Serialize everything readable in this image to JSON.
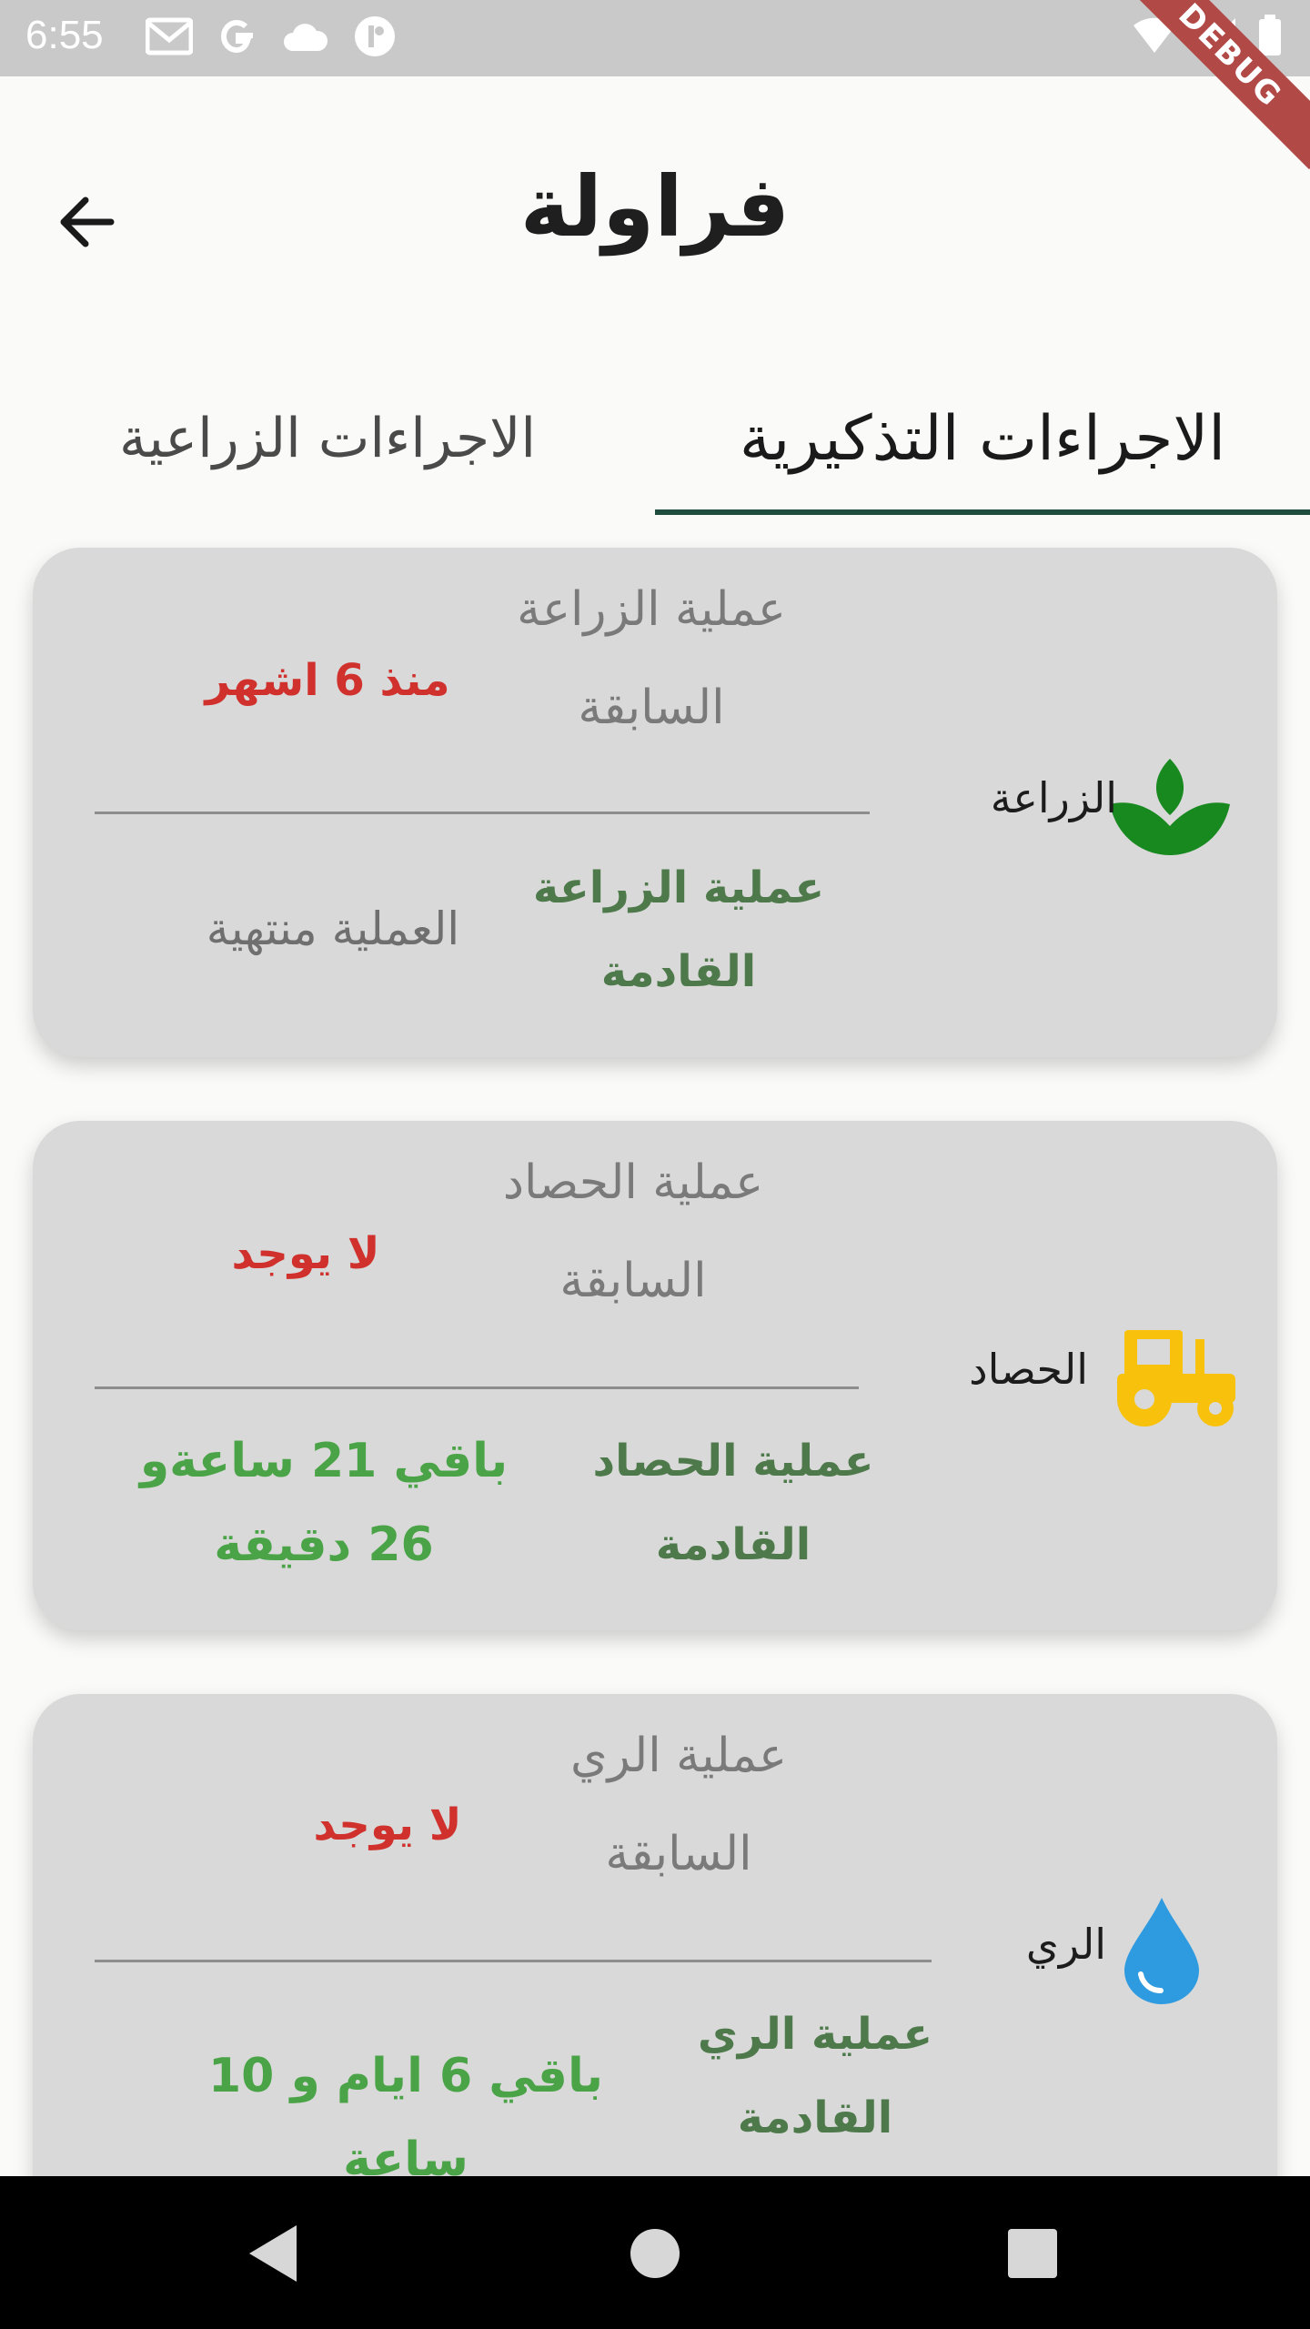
{
  "status_bar": {
    "time": "6:55",
    "debug": "DEBUG"
  },
  "header": {
    "title": "فراولة"
  },
  "tabs": {
    "reminder": "الاجراءات التذكيرية",
    "agricultural": "الاجراءات الزراعية"
  },
  "cards": [
    {
      "name": "الزراعة",
      "icon": "plant-icon",
      "prev_label": "عملية الزراعة السابقة",
      "prev_value": "منذ 6 اشهر",
      "next_label": "عملية الزراعة القادمة",
      "next_value": "العملية منتهية"
    },
    {
      "name": "الحصاد",
      "icon": "tractor-icon",
      "prev_label": "عملية الحصاد السابقة",
      "prev_value": "لا يوجد",
      "next_label": "عملية الحصاد القادمة",
      "next_value": "باقي 21 ساعةو 26 دقيقة"
    },
    {
      "name": "الري",
      "icon": "water-drop-icon",
      "prev_label": "عملية الري السابقة",
      "prev_value": "لا يوجد",
      "next_label": "عملية الري القادمة",
      "next_value": "باقي 6 ايام و 10 ساعة"
    }
  ],
  "colors": {
    "accent": "#1f4d3d",
    "card": "#d9d9d9",
    "red": "#d0312d",
    "green": "#4aa447",
    "plant": "#17891f",
    "tractor": "#f7c10c",
    "water": "#2e9be0"
  }
}
